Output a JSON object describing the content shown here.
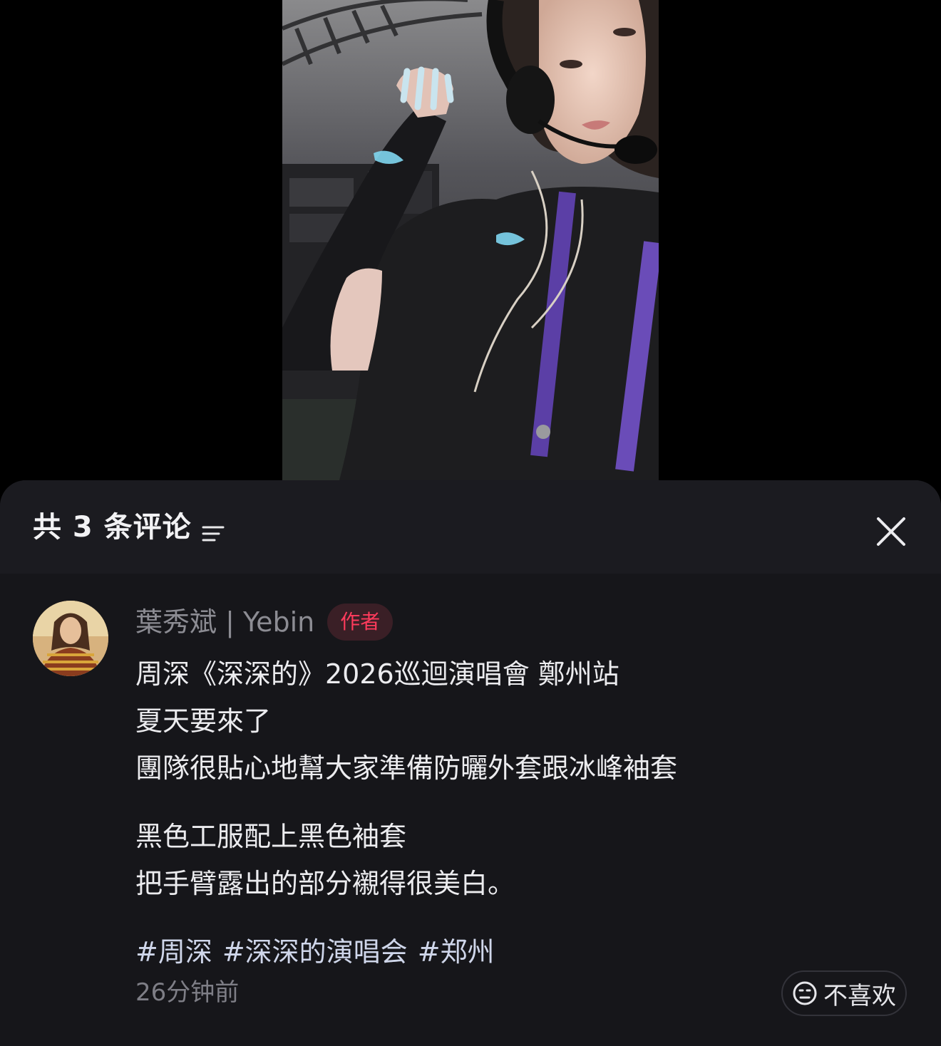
{
  "header": {
    "comment_count_label": "共 3 条评论"
  },
  "comment": {
    "author": "葉秀斌 | Yebin",
    "author_badge": "作者",
    "body_lines_1": [
      "周深《深深的》2026巡迴演唱會 鄭州站",
      "夏天要來了",
      "團隊很貼心地幫大家準備防曬外套跟冰峰袖套"
    ],
    "body_lines_2": [
      "黑色工服配上黑色袖套",
      "把手臂露出的部分襯得很美白。"
    ],
    "hashtags": [
      "#周深",
      "#深深的演唱会",
      "#郑州"
    ],
    "timestamp": "26分钟前",
    "dislike_label": "不喜欢"
  },
  "colors": {
    "sheet_background": "#16161a",
    "header_background": "#1b1b20",
    "author_badge_text": "#ff3b5c",
    "hashtag": "#cfd6ea"
  },
  "icons": {
    "sort": "sort-lines-icon",
    "close": "close-icon",
    "dislike": "neutral-face-icon"
  }
}
